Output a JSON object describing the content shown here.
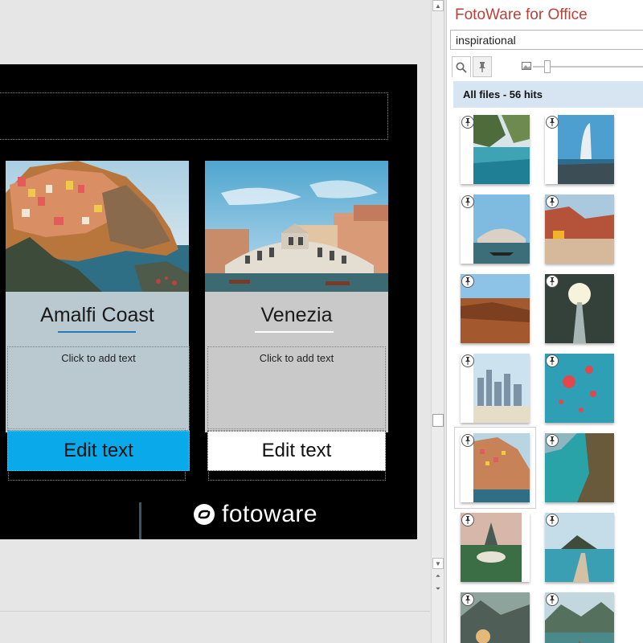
{
  "slide": {
    "cards": [
      {
        "heading": "Amalfi Coast",
        "body_placeholder": "Click to add text",
        "button_label": "Edit text"
      },
      {
        "heading": "Venezia",
        "body_placeholder": "Click to add text",
        "button_label": "Edit text"
      }
    ],
    "logo_text": "fotoware"
  },
  "pane": {
    "title": "FotoWare for Office",
    "search_value": "inspirational",
    "results_label": "All files - 56 hits"
  },
  "thumbnails": [
    {
      "name": "infinity-pool"
    },
    {
      "name": "dubai-burj-al-arab"
    },
    {
      "name": "venice-gondola"
    },
    {
      "name": "desert-road-car"
    },
    {
      "name": "canyon-sunset"
    },
    {
      "name": "forest-bridge"
    },
    {
      "name": "city-skyline"
    },
    {
      "name": "hot-air-balloons"
    },
    {
      "name": "cinque-terre"
    },
    {
      "name": "coastal-cliff"
    },
    {
      "name": "buddha-statue"
    },
    {
      "name": "island-pier"
    },
    {
      "name": "woman-mountains"
    },
    {
      "name": "lake-boat"
    }
  ],
  "colors": {
    "accent_blue": "#0aaaea",
    "pane_title_red": "#b8413a",
    "results_header_bg": "#d7e5f2"
  }
}
